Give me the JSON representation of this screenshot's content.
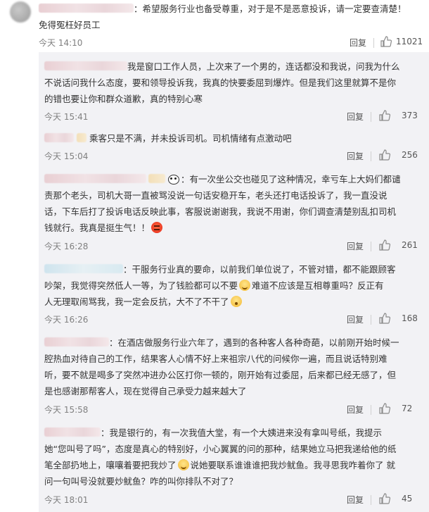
{
  "top_comment": {
    "text": "：希望服务行业也备受尊重，对于是不是恶意投诉，请一定要查清楚！",
    "text_line2": "免得冤枉好员工",
    "time": "今天 14:10",
    "reply_label": "回复",
    "like_count": "11021"
  },
  "replies": [
    {
      "lines": [
        "我是窗口工作人员，上次来了一个男的，连话都没和我说，问我为什么",
        "不说话问我什么态度，要和领导投诉我，我真的快要委屈到爆炸。但是我们这里就算不是你",
        "的错也要让你和群众道歉，真的特别心寒"
      ],
      "time": "今天 15:41",
      "reply_label": "回复",
      "like_count": "373"
    },
    {
      "lines": [
        "乘客只是不满，并未投诉司机。司机情绪有点激动吧"
      ],
      "time": "今天 15:04",
      "reply_label": "回复",
      "like_count": "256"
    },
    {
      "lines": [
        "：有一次坐公交也碰见了这种情况，幸亏车上大妈们都谴",
        "责那个老头，司机大哥一直被骂没说一句话安稳开车，老头还打电话投诉了，我一直没说",
        "话，下车后打了投诉电话反映此事，客服说谢谢我，我说不用谢，你们调查清楚别乱扣司机",
        "钱就行。我真是挺生气！！"
      ],
      "time": "今天 16:28",
      "reply_label": "回复",
      "like_count": "261"
    },
    {
      "lines": [
        "：干服务行业真的要命，以前我们单位说了，不管对错，都不能跟顾客",
        "吵架，我觉得突然低人一等，为了钱脸都可以不要",
        "难道不应该是互相尊重吗？反正有",
        "人无理取闹骂我，我一定会反抗，大不了不干了"
      ],
      "time": "今天 16:26",
      "reply_label": "回复",
      "like_count": "168"
    },
    {
      "lines": [
        "：在酒店做服务行业六年了，遇到的各种客人各种奇葩，以前刚开始时候一",
        "腔热血对待自己的工作，结果客人心情不好上来祖宗八代的问候你一遍，而且说话特别难",
        "听，要不就是喝多了突然冲进办公区打你一顿的，刚开始有过委屈，后来都已经无感了，但",
        "是也感谢那帮客人，现在觉得自己承受力越来越大了"
      ],
      "time": "今天 15:58",
      "reply_label": "回复",
      "like_count": "72"
    },
    {
      "lines": [
        "：我是银行的，有一次我值大堂，有一个大姨进来没有拿叫号纸，我提示",
        "她“您叫号了吗”，态度是真心的特别好，小心翼翼的问的那种，结果她立马把我递给他的纸",
        "笔全部扔地上，嚷嚷着要把我炒了",
        "说她要联系谁谁谁把我炒鱿鱼。我寻思我咋着你了 就",
        "问一句叫号没就要炒鱿鱼？咋的叫你排队不对了？"
      ],
      "time": "今天 18:01",
      "reply_label": "回复",
      "like_count": "45"
    }
  ],
  "colors": {
    "reply_bg": "#f2f2f5",
    "text": "#333333",
    "meta": "#808080"
  }
}
